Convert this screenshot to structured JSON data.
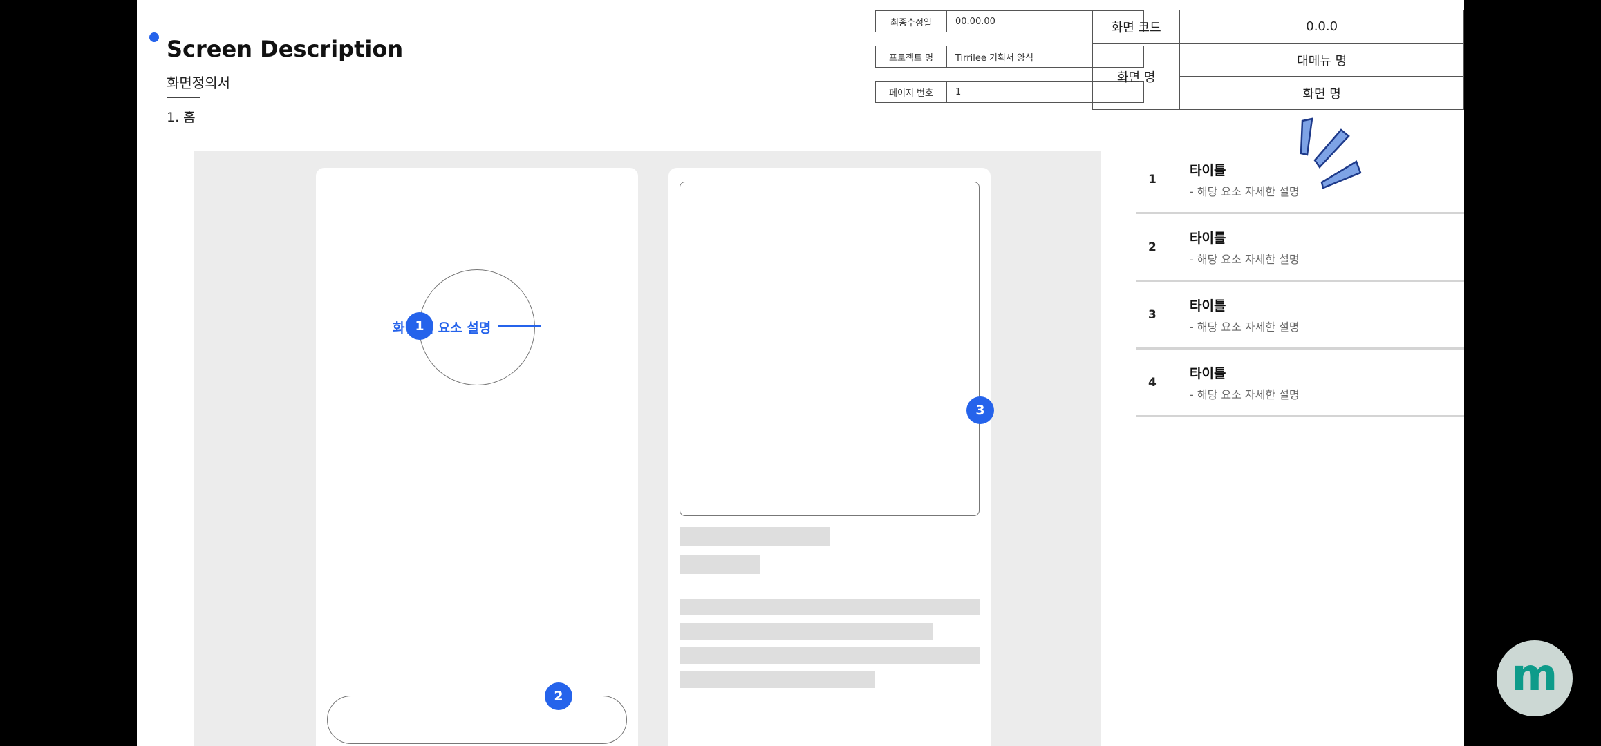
{
  "header": {
    "title": "Screen Description",
    "subtitle": "화면정의서",
    "section": "1. 홈"
  },
  "meta": {
    "updated_label": "최종수정일",
    "updated_value": "00.00.00",
    "project_label": "프로젝트 명",
    "project_value": "Tirrilee 기획서 양식",
    "page_label": "페이지 번호",
    "page_value": "1"
  },
  "screen_info": {
    "code_label": "화면 코드",
    "code_value": "0.0.0",
    "name_label": "화면 명",
    "menu_value": "대메뉴 명",
    "name_value": "화면 명"
  },
  "descriptions": [
    {
      "num": "1",
      "title": "타이틀",
      "desc": "- 해당 요소 자세한 설명"
    },
    {
      "num": "2",
      "title": "타이틀",
      "desc": "- 해당 요소 자세한 설명"
    },
    {
      "num": "3",
      "title": "타이틀",
      "desc": "- 해당 요소 자세한 설명"
    },
    {
      "num": "4",
      "title": "타이틀",
      "desc": "- 해당 요소 자세한 설명"
    }
  ],
  "wireframe": {
    "callout_text": "화면 내 요소 설명",
    "markers": [
      "1",
      "2",
      "3"
    ]
  },
  "colors": {
    "accent": "#2563eb",
    "placeholder": "#dedede",
    "canvas": "#ececec",
    "fab": "#ccd8d4",
    "fab_glyph": "#0e9b8a"
  },
  "fab": {
    "glyph": "m",
    "icon": "m-logo-icon"
  }
}
